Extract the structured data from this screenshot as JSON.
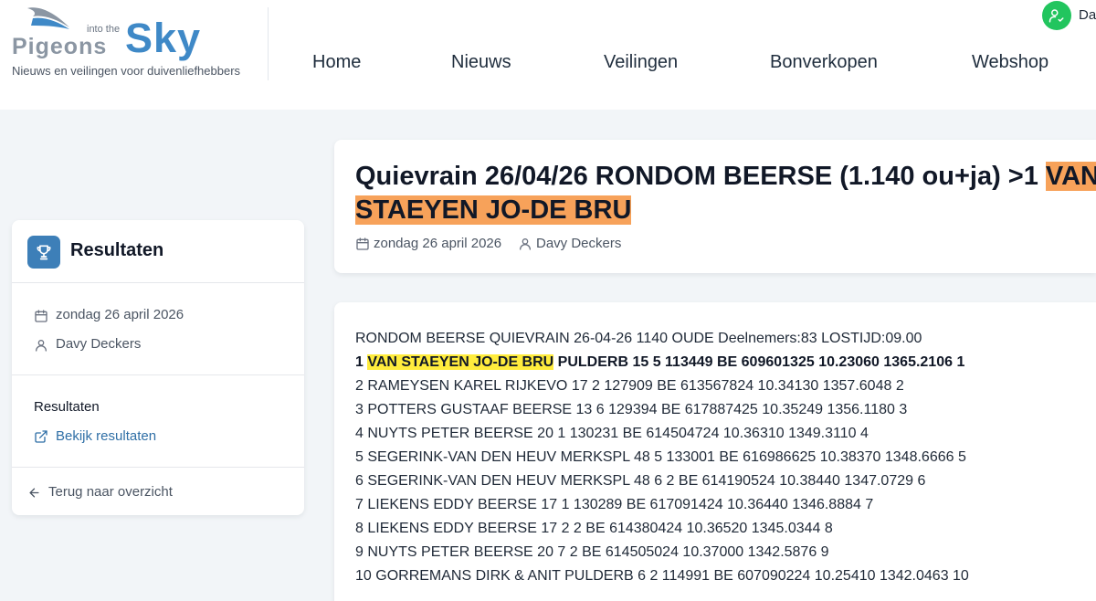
{
  "brand": {
    "name_pigeons": "Pigeons",
    "name_intothe": "into the",
    "name_sky": "Sky",
    "tagline": "Nieuws en veilingen voor duivenliefhebbers"
  },
  "nav": {
    "items": [
      {
        "label": "Home"
      },
      {
        "label": "Nieuws"
      },
      {
        "label": "Veilingen"
      },
      {
        "label": "Bonverkopen"
      },
      {
        "label": "Webshop"
      }
    ]
  },
  "user": {
    "name_visible": "Da",
    "avatar_icon": "user-check-icon",
    "avatar_color": "#22c55e"
  },
  "sidebar": {
    "title": "Resultaten",
    "title_icon": "trophy-icon",
    "date": "zondag 26 april 2026",
    "author": "Davy Deckers",
    "results_label": "Resultaten",
    "results_link": "Bekijk resultaten",
    "back_link": "Terug naar overzicht"
  },
  "article": {
    "title_plain": "Quievrain 26/04/26 RONDOM BEERSE (1.140 ou+ja) >1 ",
    "title_highlight": "VAN STAEYEN JO-DE BRU",
    "date": "zondag 26 april 2026",
    "author": "Davy Deckers",
    "highlight_color": "#f7a25a"
  },
  "results": {
    "header": "RONDOM BEERSE QUIEVRAIN 26-04-26 1140 OUDE Deelnemers:83 LOSTIJD:09.00",
    "winner_prefix": "1 ",
    "winner_name": "VAN STAEYEN JO-DE BRU",
    "winner_rest": " PULDERB 15 5 113449 BE 609601325 10.23060 1365.2106 1",
    "lines": [
      "2 RAMEYSEN KAREL RIJKEVO 17 2 127909 BE 613567824 10.34130 1357.6048 2",
      "3 POTTERS GUSTAAF BEERSE 13 6 129394 BE 617887425 10.35249 1356.1180 3",
      "4 NUYTS PETER BEERSE 20 1 130231 BE 614504724 10.36310 1349.3110 4",
      "5 SEGERINK-VAN DEN HEUV MERKSPL 48 5 133001 BE 616986625 10.38370 1348.6666 5",
      "6 SEGERINK-VAN DEN HEUV MERKSPL 48 6 2 BE 614190524 10.38440 1347.0729 6",
      "7 LIEKENS EDDY BEERSE 17 1 130289 BE 617091424 10.36440 1346.8884 7",
      "8 LIEKENS EDDY BEERSE 17 2 2 BE 614380424 10.36520 1345.0344 8",
      "9 NUYTS PETER BEERSE 20 7 2 BE 614505024 10.37000 1342.5876 9",
      "10 GORREMANS DIRK & ANIT PULDERB 6 2 114991 BE 607090224 10.25410 1342.0463 10"
    ],
    "highlight_color": "#ffec3d"
  }
}
